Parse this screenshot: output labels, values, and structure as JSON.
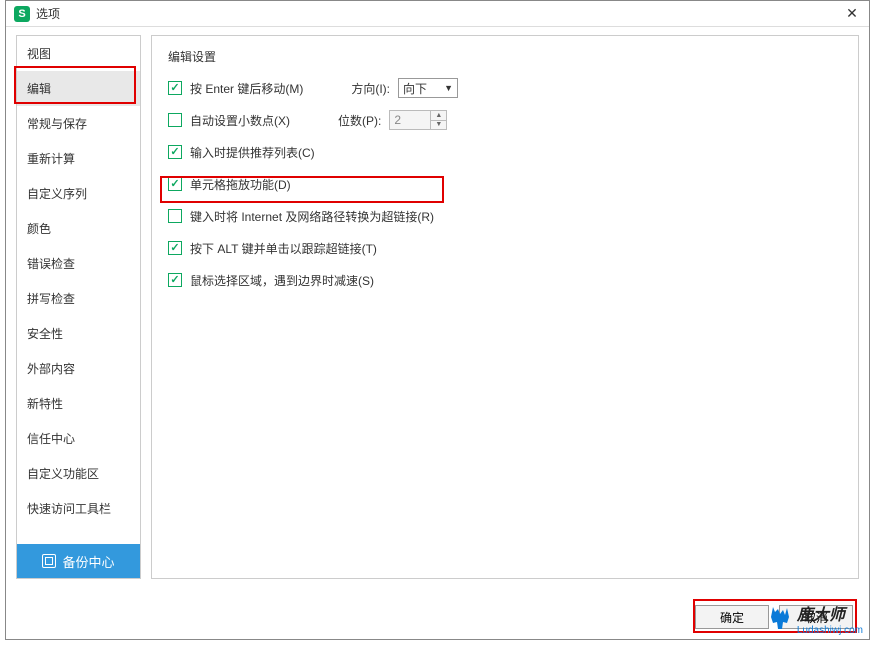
{
  "title": "选项",
  "sidebar": {
    "items": [
      {
        "label": "视图"
      },
      {
        "label": "编辑"
      },
      {
        "label": "常规与保存"
      },
      {
        "label": "重新计算"
      },
      {
        "label": "自定义序列"
      },
      {
        "label": "颜色"
      },
      {
        "label": "错误检查"
      },
      {
        "label": "拼写检查"
      },
      {
        "label": "安全性"
      },
      {
        "label": "外部内容"
      },
      {
        "label": "新特性"
      },
      {
        "label": "信任中心"
      },
      {
        "label": "自定义功能区"
      },
      {
        "label": "快速访问工具栏"
      }
    ],
    "selected_index": 1,
    "backup_label": "备份中心"
  },
  "content": {
    "section_title": "编辑设置",
    "options": [
      {
        "checked": true,
        "label": "按 Enter 键后移动(M)",
        "aux": {
          "label": "方向(I):",
          "type": "dropdown",
          "value": "向下"
        }
      },
      {
        "checked": false,
        "label": "自动设置小数点(X)",
        "aux": {
          "label": "位数(P):",
          "type": "spinner",
          "value": "2"
        }
      },
      {
        "checked": true,
        "label": "输入时提供推荐列表(C)"
      },
      {
        "checked": true,
        "label": "单元格拖放功能(D)"
      },
      {
        "checked": false,
        "label": "键入时将 Internet 及网络路径转换为超链接(R)"
      },
      {
        "checked": true,
        "label": "按下 ALT 键并单击以跟踪超链接(T)"
      },
      {
        "checked": true,
        "label": "鼠标选择区域，遇到边界时减速(S)"
      }
    ]
  },
  "footer": {
    "ok": "确定",
    "cancel": "取消"
  },
  "watermark": {
    "brand": "鹿大师",
    "url": "Ludashiwj.com"
  }
}
